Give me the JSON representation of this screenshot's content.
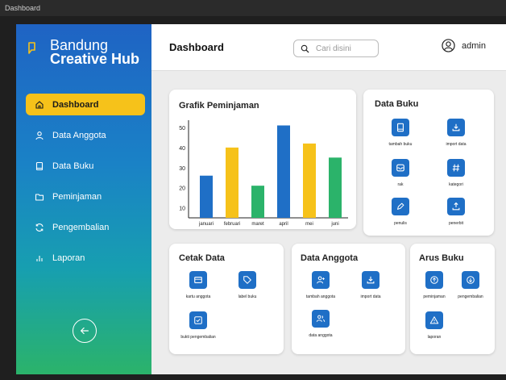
{
  "window": {
    "title": "Dashboard"
  },
  "brand": {
    "line1": "Bandung",
    "line2": "Creative Hub"
  },
  "sidebar": {
    "items": [
      {
        "label": "Dashboard",
        "icon": "home-icon",
        "active": true
      },
      {
        "label": "Data Anggota",
        "icon": "user-icon",
        "active": false
      },
      {
        "label": "Data Buku",
        "icon": "book-icon",
        "active": false
      },
      {
        "label": "Peminjaman",
        "icon": "folder-icon",
        "active": false
      },
      {
        "label": "Pengembalian",
        "icon": "refresh-icon",
        "active": false
      },
      {
        "label": "Laporan",
        "icon": "bar-chart-icon",
        "active": false
      }
    ],
    "back_icon": "arrow-left-circle-icon"
  },
  "header": {
    "title": "Dashboard",
    "search_placeholder": "Cari disini",
    "user_name": "admin"
  },
  "colors": {
    "accent": "#1f6fc6",
    "active_nav": "#f6c21a",
    "bar_blue": "#1f6fc6",
    "bar_yellow": "#f6c21a",
    "bar_green": "#2bb36a"
  },
  "chart_card": {
    "title": "Grafik Peminjaman"
  },
  "chart_data": {
    "type": "bar",
    "title": "Grafik Peminjaman",
    "categories": [
      "januari",
      "februari",
      "maret",
      "april",
      "mei",
      "juni"
    ],
    "values": [
      26,
      40,
      21,
      51,
      42,
      35
    ],
    "bar_colors": [
      "#1f6fc6",
      "#f6c21a",
      "#2bb36a",
      "#1f6fc6",
      "#f6c21a",
      "#2bb36a"
    ],
    "yticks": [
      10,
      20,
      30,
      40,
      50
    ],
    "ylim": [
      5,
      52
    ],
    "grid": false
  },
  "data_buku": {
    "title": "Data Buku",
    "tiles": [
      {
        "label": "tambah buku",
        "icon": "book-icon"
      },
      {
        "label": "import data",
        "icon": "download-icon"
      },
      {
        "label": "rak",
        "icon": "inbox-icon"
      },
      {
        "label": "kategori",
        "icon": "hash-icon"
      },
      {
        "label": "penulis",
        "icon": "pen-icon"
      },
      {
        "label": "penerbit",
        "icon": "upload-icon"
      }
    ]
  },
  "cetak_data": {
    "title": "Cetak Data",
    "tiles": [
      {
        "label": "kartu anggota",
        "icon": "card-icon"
      },
      {
        "label": "label buku",
        "icon": "tag-icon"
      },
      {
        "label": "bukti pengembalian",
        "icon": "check-square-icon"
      }
    ]
  },
  "data_anggota": {
    "title": "Data Anggota",
    "tiles": [
      {
        "label": "tambah anggota",
        "icon": "user-plus-icon"
      },
      {
        "label": "import data",
        "icon": "download-icon"
      },
      {
        "label": "data anggota",
        "icon": "users-icon"
      }
    ]
  },
  "arus_buku": {
    "title": "Arus Buku",
    "tiles": [
      {
        "label": "peminjaman",
        "icon": "arrow-up-circle-icon"
      },
      {
        "label": "pengembalian",
        "icon": "arrow-down-circle-icon"
      },
      {
        "label": "laporan",
        "icon": "warning-icon"
      }
    ]
  }
}
